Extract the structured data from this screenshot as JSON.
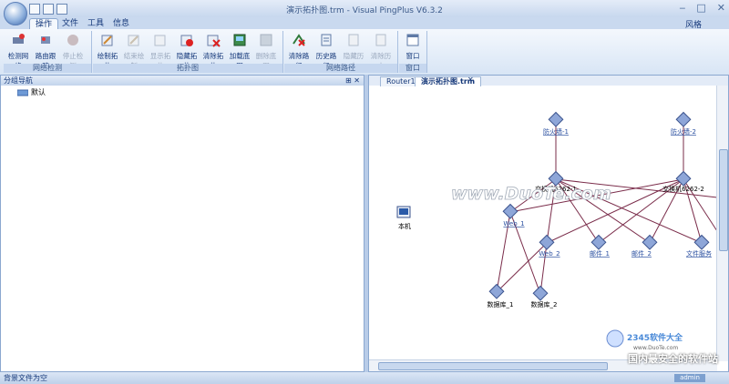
{
  "window": {
    "title": "演示拓扑图.trm - Visual PingPlus V6.3.2"
  },
  "ribbon_tabs": [
    {
      "label": "操作",
      "active": true
    },
    {
      "label": "文件",
      "active": false
    },
    {
      "label": "工具",
      "active": false
    },
    {
      "label": "信息",
      "active": false
    }
  ],
  "style_label": "风格",
  "groups": [
    {
      "label": "网络检测",
      "buttons": [
        {
          "label": "检测网络",
          "enabled": true,
          "icon": "network-detect-icon"
        },
        {
          "label": "路由跟踪",
          "enabled": true,
          "icon": "route-trace-icon"
        },
        {
          "label": "停止检测",
          "enabled": false,
          "icon": "stop-detect-icon"
        }
      ]
    },
    {
      "label": "拓扑图",
      "buttons": [
        {
          "label": "绘制拓扑",
          "enabled": true,
          "icon": "draw-topology-icon"
        },
        {
          "label": "结束绘制",
          "enabled": false,
          "icon": "end-draw-icon"
        },
        {
          "label": "显示拓扑",
          "enabled": false,
          "icon": "show-topology-icon"
        },
        {
          "label": "隐藏拓扑",
          "enabled": true,
          "icon": "hide-topology-icon"
        },
        {
          "label": "清除拓扑",
          "enabled": true,
          "icon": "clear-topology-icon"
        },
        {
          "label": "加载底图",
          "enabled": true,
          "icon": "load-basemap-icon"
        },
        {
          "label": "删除底图",
          "enabled": false,
          "icon": "delete-basemap-icon"
        }
      ]
    },
    {
      "label": "网络路径",
      "buttons": [
        {
          "label": "清除路径",
          "enabled": true,
          "icon": "clear-path-icon"
        },
        {
          "label": "历史路径",
          "enabled": true,
          "icon": "history-path-icon"
        },
        {
          "label": "隐藏历史",
          "enabled": false,
          "icon": "hide-history-icon"
        },
        {
          "label": "清除历史",
          "enabled": false,
          "icon": "clear-history-icon"
        }
      ]
    },
    {
      "label": "窗口",
      "buttons": [
        {
          "label": "窗口",
          "enabled": true,
          "icon": "window-icon"
        }
      ]
    }
  ],
  "left_panel": {
    "title": "分组导航",
    "pin_label": "⊞ ✕",
    "tree": [
      {
        "label": "默认"
      }
    ]
  },
  "doc_tabs": [
    {
      "label": "Router1",
      "active": false
    },
    {
      "label": "演示拓扑图.trm",
      "active": true
    }
  ],
  "topology": {
    "nodes": [
      {
        "label": "防火墙-1"
      },
      {
        "label": "防火墙-2"
      },
      {
        "label": "交换机6262-1"
      },
      {
        "label": "交换机6262-2"
      },
      {
        "label": "Web_1"
      },
      {
        "label": "Web_2"
      },
      {
        "label": "邮件_1"
      },
      {
        "label": "邮件_2"
      },
      {
        "label": "文件服务"
      },
      {
        "label": "数据库_1"
      },
      {
        "label": "数据库_2"
      },
      {
        "label": "本机"
      }
    ]
  },
  "status": {
    "left": "背景文件为空",
    "user": "admin"
  },
  "watermarks": {
    "center": "www.DuoTe.com",
    "corner_brand": "2345软件大全",
    "corner_url": "www.DuoTe.com",
    "corner_slogan": "国内最安全的软件站"
  },
  "colors": {
    "ribbon_bg": "#dbe7f6",
    "accent": "#15387a",
    "link_line": "#7a2c4a"
  }
}
